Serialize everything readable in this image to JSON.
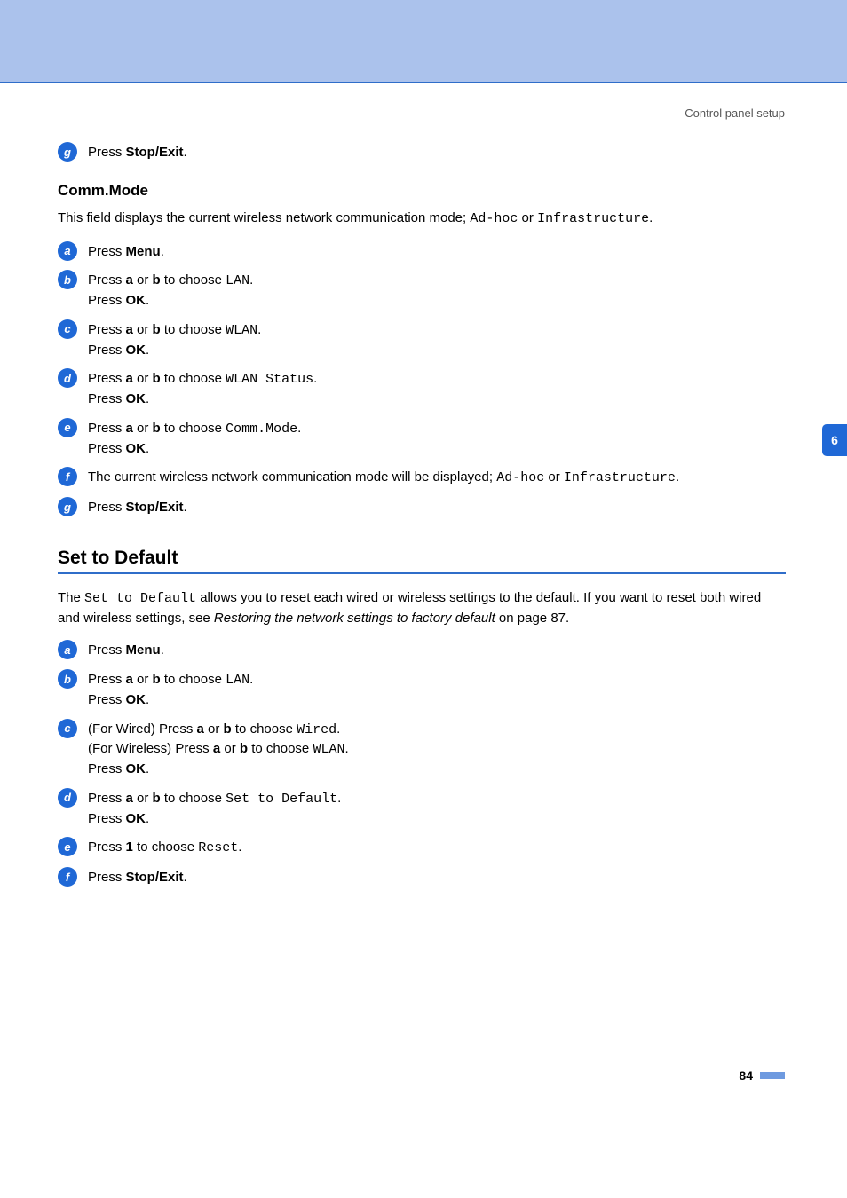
{
  "header": {
    "breadcrumb": "Control panel setup"
  },
  "sideTab": "6",
  "commPrev": {
    "step7": {
      "num": "g",
      "pressLabel": "Press ",
      "stopExit": "Stop/Exit",
      "period": "."
    }
  },
  "commMode": {
    "heading": "Comm.Mode",
    "intro": {
      "t1": "This field displays the current wireless network communication mode; ",
      "m1": "Ad-hoc",
      "t2": " or ",
      "m2": "Infrastructure",
      "t3": "."
    },
    "steps": {
      "s1": {
        "num": "a",
        "t1": "Press ",
        "b1": "Menu",
        "t2": "."
      },
      "s2": {
        "num": "b",
        "t1": "Press ",
        "b1": "a",
        "t2": " or ",
        "b2": "b",
        "t3": " to choose ",
        "m1": "LAN",
        "t4": ".",
        "line2a": "Press ",
        "line2b": "OK",
        "line2c": "."
      },
      "s3": {
        "num": "c",
        "t1": "Press ",
        "b1": "a",
        "t2": " or ",
        "b2": "b",
        "t3": " to choose ",
        "m1": "WLAN",
        "t4": ".",
        "line2a": "Press ",
        "line2b": "OK",
        "line2c": "."
      },
      "s4": {
        "num": "d",
        "t1": "Press ",
        "b1": "a",
        "t2": " or ",
        "b2": "b",
        "t3": " to choose ",
        "m1": "WLAN Status",
        "t4": ".",
        "line2a": "Press ",
        "line2b": "OK",
        "line2c": "."
      },
      "s5": {
        "num": "e",
        "t1": "Press ",
        "b1": "a",
        "t2": " or ",
        "b2": "b",
        "t3": " to choose ",
        "m1": "Comm.Mode",
        "t4": ".",
        "line2a": "Press ",
        "line2b": "OK",
        "line2c": "."
      },
      "s6": {
        "num": "f",
        "t1": "The current wireless network communication mode will be displayed; ",
        "m1": "Ad-hoc",
        "t2": " or ",
        "m2": "Infrastructure",
        "t3": "."
      },
      "s7": {
        "num": "g",
        "t1": "Press ",
        "b1": "Stop/Exit",
        "t2": "."
      }
    }
  },
  "setDefault": {
    "heading": "Set to Default",
    "intro": {
      "t1": "The ",
      "m1": "Set to Default",
      "t2": " allows you to reset each wired or wireless settings to the default. If you want to reset both wired and wireless settings, see ",
      "i1": "Restoring the network settings to factory default",
      "t3": " on page 87."
    },
    "steps": {
      "s1": {
        "num": "a",
        "t1": "Press ",
        "b1": "Menu",
        "t2": "."
      },
      "s2": {
        "num": "b",
        "t1": "Press ",
        "b1": "a",
        "t2": " or ",
        "b2": "b",
        "t3": " to choose ",
        "m1": "LAN",
        "t4": ".",
        "line2a": "Press ",
        "line2b": "OK",
        "line2c": "."
      },
      "s3": {
        "num": "c",
        "l1a": "(For Wired) Press ",
        "l1b1": "a",
        "l1c": " or ",
        "l1b2": "b",
        "l1d": " to choose ",
        "l1m": "Wired",
        "l1e": ".",
        "l2a": "(For Wireless) Press ",
        "l2b1": "a",
        "l2c": " or ",
        "l2b2": "b",
        "l2d": " to choose ",
        "l2m": "WLAN",
        "l2e": ".",
        "l3a": "Press ",
        "l3b": "OK",
        "l3c": "."
      },
      "s4": {
        "num": "d",
        "t1": "Press ",
        "b1": "a",
        "t2": " or ",
        "b2": "b",
        "t3": " to choose ",
        "m1": "Set to Default",
        "t4": ".",
        "line2a": "Press ",
        "line2b": "OK",
        "line2c": "."
      },
      "s5": {
        "num": "e",
        "t1": "Press ",
        "b1": "1",
        "t2": " to choose ",
        "m1": "Reset",
        "t3": "."
      },
      "s6": {
        "num": "f",
        "t1": "Press ",
        "b1": "Stop/Exit",
        "t2": "."
      }
    }
  },
  "footer": {
    "pageNum": "84"
  }
}
